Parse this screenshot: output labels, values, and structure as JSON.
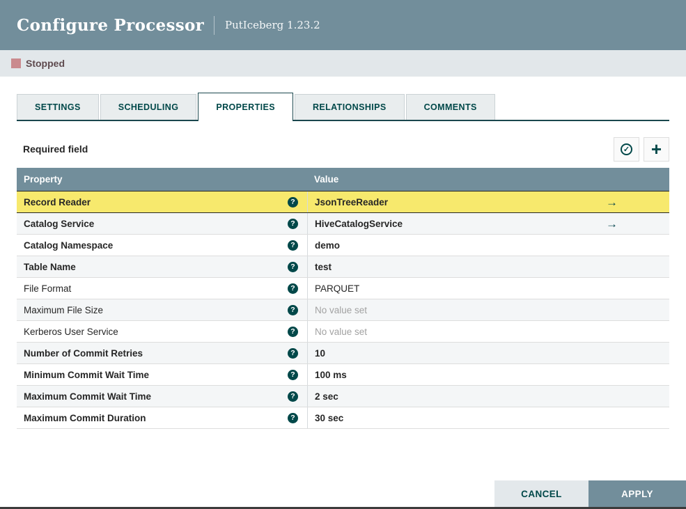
{
  "header": {
    "title": "Configure Processor",
    "subtitle": "PutIceberg 1.23.2"
  },
  "status": {
    "label": "Stopped",
    "color": "#CA8A8E"
  },
  "tabs": [
    {
      "label": "SETTINGS",
      "active": false
    },
    {
      "label": "SCHEDULING",
      "active": false
    },
    {
      "label": "PROPERTIES",
      "active": true
    },
    {
      "label": "RELATIONSHIPS",
      "active": false
    },
    {
      "label": "COMMENTS",
      "active": false
    }
  ],
  "toolbar": {
    "required_label": "Required field",
    "icons": [
      {
        "name": "verify-properties-icon",
        "glyph": "check-circle"
      },
      {
        "name": "add-property-icon",
        "glyph": "plus"
      }
    ]
  },
  "table": {
    "columns": {
      "property": "Property",
      "value": "Value"
    },
    "help_icon_glyph": "?",
    "arrow_glyph": "→",
    "rows": [
      {
        "property": "Record Reader",
        "value": "JsonTreeReader",
        "required": true,
        "value_set": true,
        "has_arrow": true,
        "selected": true
      },
      {
        "property": "Catalog Service",
        "value": "HiveCatalogService",
        "required": true,
        "value_set": true,
        "has_arrow": true,
        "selected": false
      },
      {
        "property": "Catalog Namespace",
        "value": "demo",
        "required": true,
        "value_set": true,
        "has_arrow": false,
        "selected": false
      },
      {
        "property": "Table Name",
        "value": "test",
        "required": true,
        "value_set": true,
        "has_arrow": false,
        "selected": false
      },
      {
        "property": "File Format",
        "value": "PARQUET",
        "required": false,
        "value_set": true,
        "has_arrow": false,
        "selected": false
      },
      {
        "property": "Maximum File Size",
        "value": "No value set",
        "required": false,
        "value_set": false,
        "has_arrow": false,
        "selected": false
      },
      {
        "property": "Kerberos User Service",
        "value": "No value set",
        "required": false,
        "value_set": false,
        "has_arrow": false,
        "selected": false
      },
      {
        "property": "Number of Commit Retries",
        "value": "10",
        "required": true,
        "value_set": true,
        "has_arrow": false,
        "selected": false
      },
      {
        "property": "Minimum Commit Wait Time",
        "value": "100 ms",
        "required": true,
        "value_set": true,
        "has_arrow": false,
        "selected": false
      },
      {
        "property": "Maximum Commit Wait Time",
        "value": "2 sec",
        "required": true,
        "value_set": true,
        "has_arrow": false,
        "selected": false
      },
      {
        "property": "Maximum Commit Duration",
        "value": "30 sec",
        "required": true,
        "value_set": true,
        "has_arrow": false,
        "selected": false
      }
    ]
  },
  "footer": {
    "cancel_label": "CANCEL",
    "apply_label": "APPLY"
  },
  "colors": {
    "header_bg": "#728E9B",
    "accent_teal": "#004849",
    "selected_row_bg": "#F7E96D",
    "status_bar_bg": "#E2E7EA",
    "alt_row_bg": "#F4F6F7",
    "no_value_text": "#A2A2A2"
  }
}
